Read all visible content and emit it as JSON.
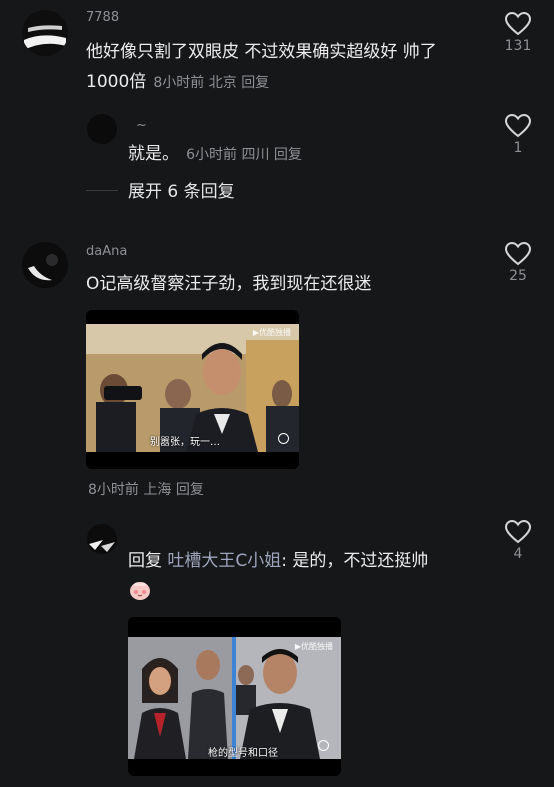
{
  "comments": [
    {
      "username": "7788",
      "text_line1": "他好像只割了双眼皮 不过效果确实超级好 帅了",
      "text_line2": "1000倍",
      "time": "8小时前",
      "location": "北京",
      "reply": "回复",
      "likes": "131"
    },
    {
      "username": "~",
      "text": "就是。",
      "time": "6小时前",
      "location": "四川",
      "reply": "回复",
      "likes": "1"
    },
    {
      "username": "daAna",
      "text": "O记高级督察汪子劲，我到现在还很迷",
      "time": "8小时前",
      "location": "上海",
      "reply": "回复",
      "likes": "25",
      "video": {
        "subtitle": "别嚣张，玩一…",
        "watermark": "▶优酷独播"
      }
    },
    {
      "username": "",
      "reply_prefix": "回复",
      "mention": "吐槽大王C小姐",
      "text": ": 是的，不过还挺帅",
      "likes": "4",
      "video": {
        "subtitle": "枪的型号和口径",
        "watermark": "▶优酷独播"
      }
    }
  ],
  "expand_replies": "展开 6 条回复",
  "icons": {
    "like": "heart-outline-icon",
    "emoji": "blush-emoji-icon",
    "video_control": "circle-icon"
  },
  "colors": {
    "background": "#161719",
    "text": "#ececee",
    "meta": "#8f9095"
  }
}
